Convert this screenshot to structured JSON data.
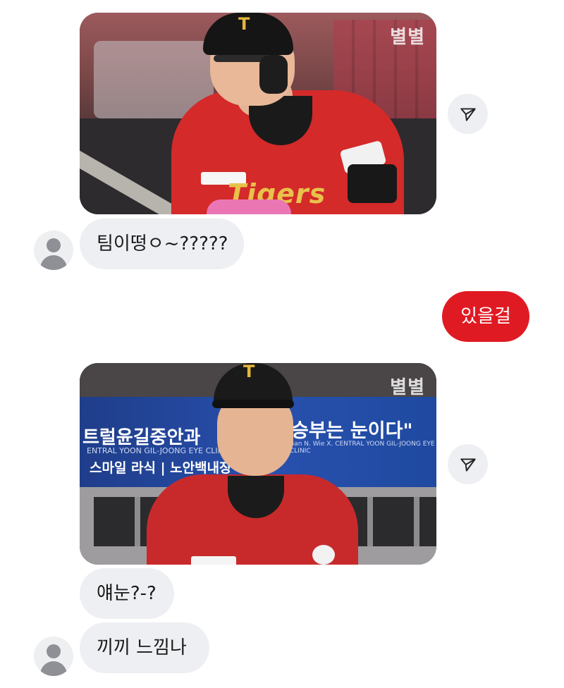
{
  "chat": {
    "watermark": "별별",
    "messages": [
      {
        "sender": "other",
        "type": "image",
        "image_text": "Tigers"
      },
      {
        "sender": "other",
        "type": "text",
        "text": "팀이떵ㅇ~?????"
      },
      {
        "sender": "me",
        "type": "text",
        "text": "있을걸"
      },
      {
        "sender": "other",
        "type": "image",
        "image_text_lines": [
          "트럴윤길중안과",
          "ENTRAL YOON GIL-JOONG EYE CLINIC",
          "스마일 라식 | 노안백내장",
          "승부는 눈이다\"",
          "Ban N. Wie X. CENTRAL YOON GIL-JOONG EYE CLINIC"
        ]
      },
      {
        "sender": "other",
        "type": "text",
        "text": "얘눈?-?"
      },
      {
        "sender": "other",
        "type": "text",
        "text": "끼끼 느낌나"
      }
    ]
  },
  "colors": {
    "my_bubble": "#e01a23",
    "other_bubble": "#eeeff3",
    "share_button": "#eeeff3",
    "avatar_placeholder": "#8e9096"
  },
  "icons": {
    "share": "paper-plane-icon",
    "avatar": "default-avatar-icon"
  }
}
